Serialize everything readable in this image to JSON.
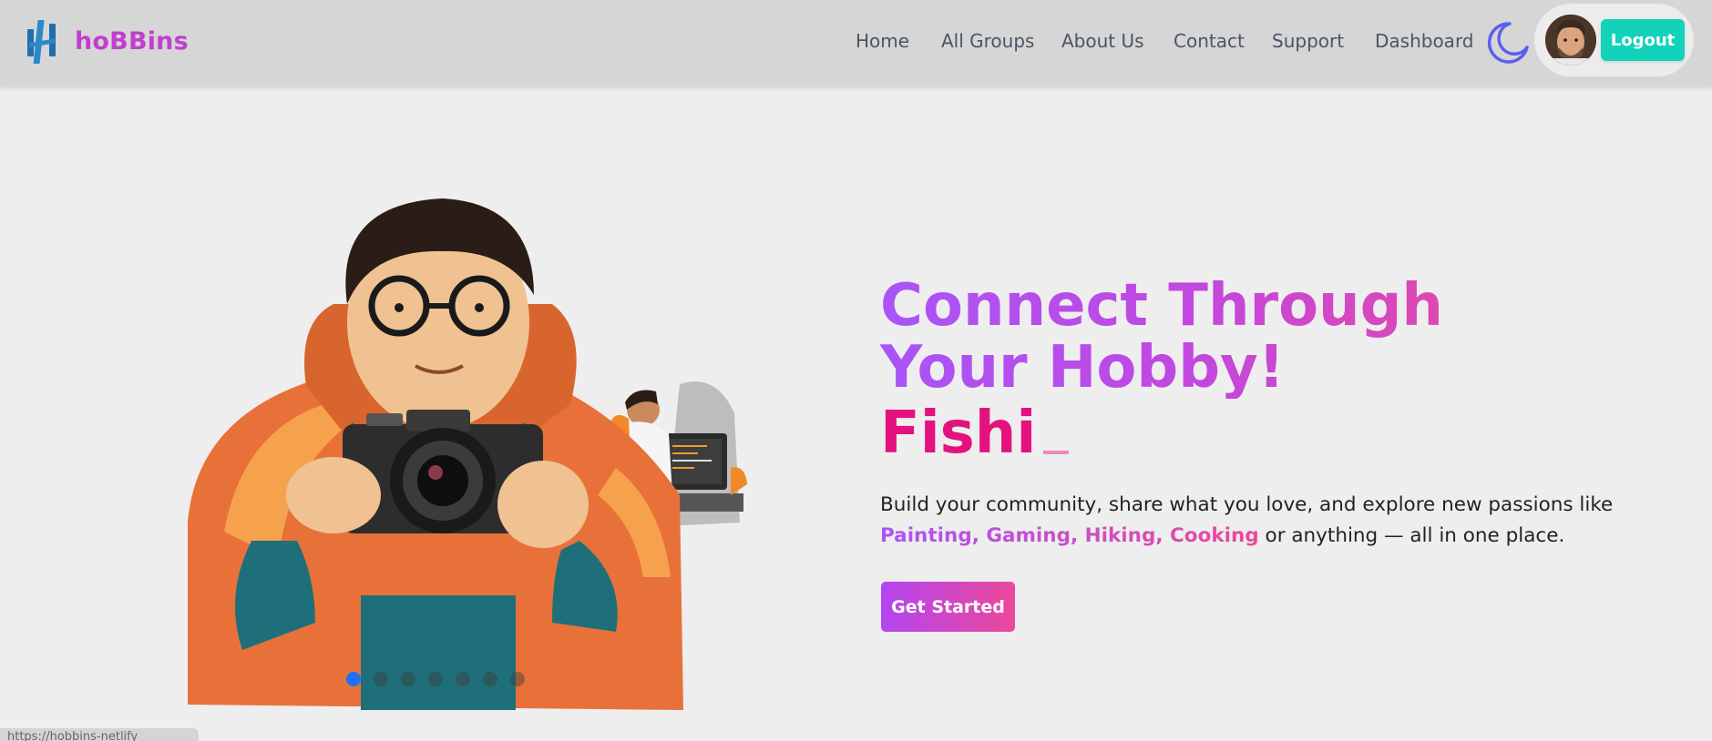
{
  "brand": {
    "name": "hoBBins",
    "logo_icon": "hobbins-logo-icon",
    "name_color": "#c13fcf"
  },
  "nav": {
    "links": [
      "Home",
      "All Groups",
      "About Us",
      "Contact",
      "Support",
      "Dashboard"
    ],
    "theme_icon": "moon-icon"
  },
  "user": {
    "avatar_icon": "user-avatar",
    "logout_label": "Logout"
  },
  "hero": {
    "title": "Connect Through Your Hobby!",
    "typed_text": "Fishi",
    "description_before": "Build your community, share what you love, and explore new passions like ",
    "hobbies": "Painting, Gaming, Hiking, Cooking",
    "description_after": " or anything — all in one place.",
    "cta_label": "Get Started",
    "carousel": {
      "total_slides": 7,
      "active_index": 0
    }
  },
  "status_bar": {
    "url": "https://hobbins-netlify"
  },
  "colors": {
    "navbar_bg": "#d6d6d6",
    "page_bg": "#eeeeee",
    "logout_bg": "#12d2b9",
    "gradient_start": "#a855f7",
    "gradient_end": "#ec4899",
    "typed_text": "#e3127f",
    "dot_active": "#1d72f5"
  }
}
